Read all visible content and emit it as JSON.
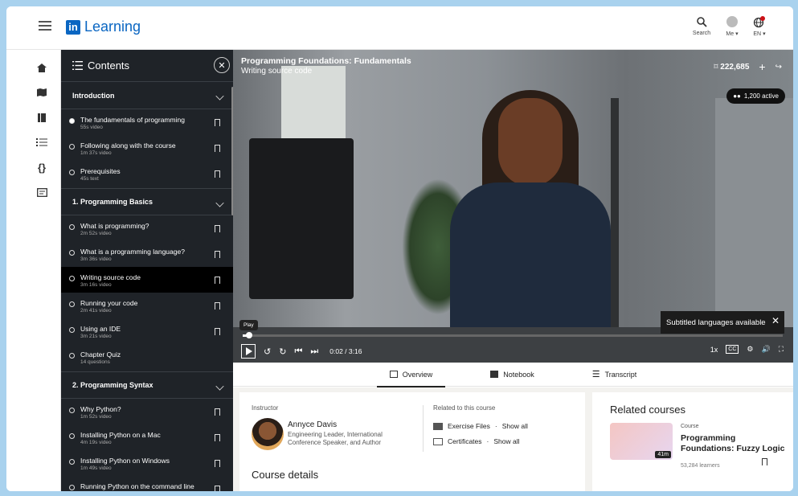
{
  "app": {
    "title": "Learning"
  },
  "topnav": {
    "search": "Search",
    "me": "Me",
    "lang": "EN"
  },
  "contents": {
    "title": "Contents",
    "sections": [
      {
        "title": "Introduction",
        "items": [
          {
            "title": "The fundamentals of programming",
            "meta": "55s video"
          },
          {
            "title": "Following along with the course",
            "meta": "1m 37s video"
          },
          {
            "title": "Prerequisites",
            "meta": "45s text"
          }
        ]
      },
      {
        "title": "1. Programming Basics",
        "items": [
          {
            "title": "What is programming?",
            "meta": "2m 52s video"
          },
          {
            "title": "What is a programming language?",
            "meta": "3m 36s video"
          },
          {
            "title": "Writing source code",
            "meta": "3m 16s video"
          },
          {
            "title": "Running your code",
            "meta": "2m 41s video"
          },
          {
            "title": "Using an IDE",
            "meta": "3m 21s video"
          },
          {
            "title": "Chapter Quiz",
            "meta": "14 questions"
          }
        ]
      },
      {
        "title": "2. Programming Syntax",
        "items": [
          {
            "title": "Why Python?",
            "meta": "1m 52s video"
          },
          {
            "title": "Installing Python on a Mac",
            "meta": "4m 19s video"
          },
          {
            "title": "Installing Python on Windows",
            "meta": "1m 49s video"
          },
          {
            "title": "Running Python on the command line",
            "meta": ""
          }
        ]
      }
    ]
  },
  "video": {
    "course": "Programming Foundations: Fundamentals",
    "lesson": "Writing source code",
    "count": "222,685",
    "active": "1,200 active",
    "subtitle_tip": "Subtitled languages available",
    "play_tip": "Play",
    "time": "0:02 / 3:16",
    "speed": "1x",
    "cc": "CC",
    "progress": 0.01
  },
  "tabs": [
    "Overview",
    "Notebook",
    "Transcript"
  ],
  "overview": {
    "instructor_label": "Instructor",
    "instructor_name": "Annyce Davis",
    "instructor_role": "Engineering Leader, International Conference Speaker, and Author",
    "related_label": "Related to this course",
    "exercise": "Exercise Files",
    "certificates": "Certificates",
    "show_all": "Show all",
    "dot": "·",
    "course_details": "Course details"
  },
  "related": {
    "title": "Related courses",
    "kind": "Course",
    "name": "Programming Foundations: Fuzzy Logic",
    "duration": "41m",
    "learners": "53,284 learners"
  }
}
